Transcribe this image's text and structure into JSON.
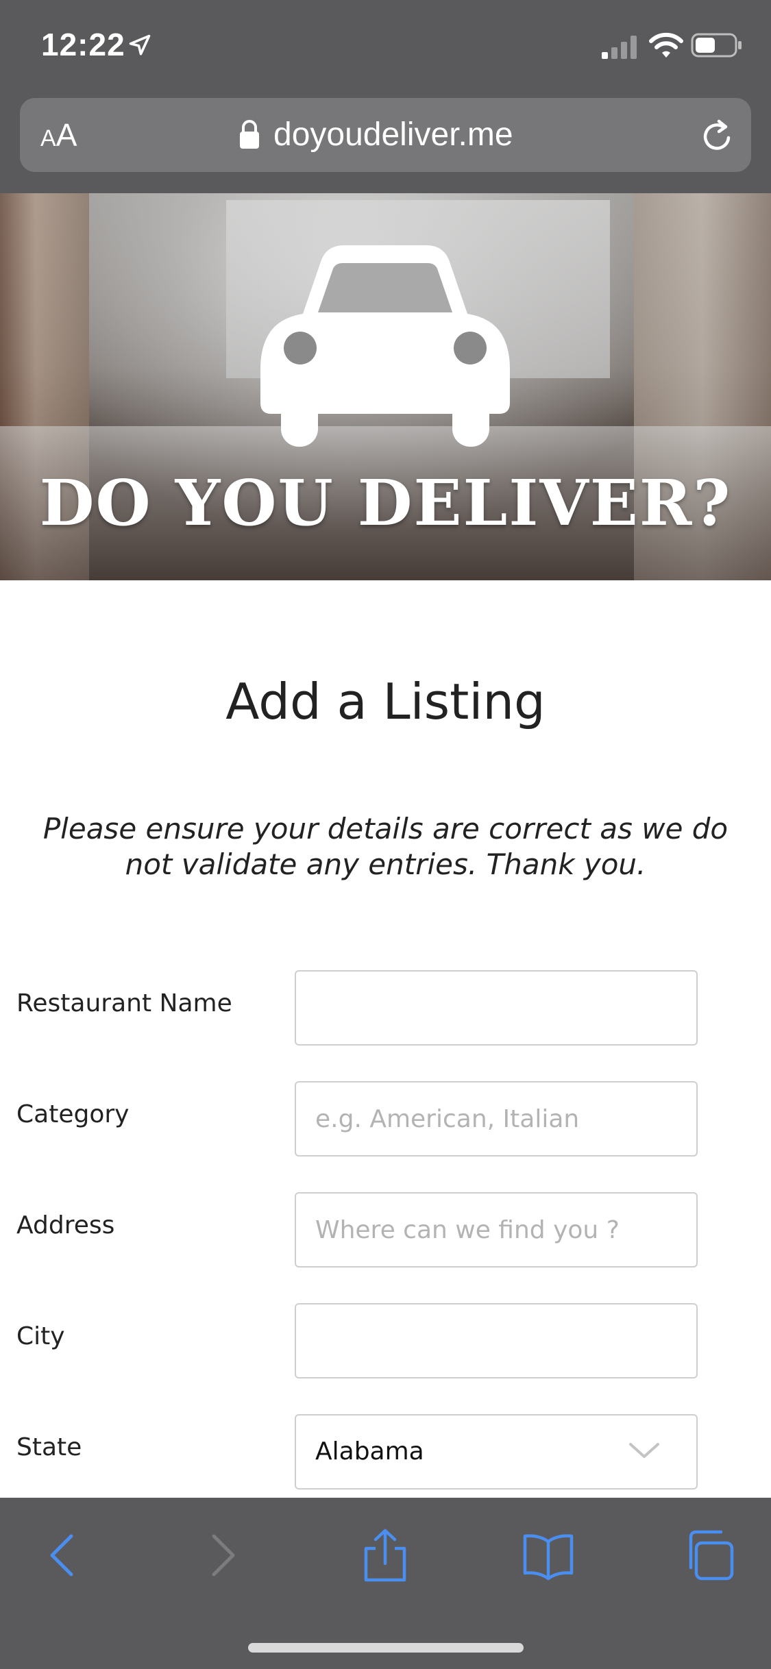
{
  "status_bar": {
    "time": "12:22"
  },
  "browser": {
    "text_size_small": "A",
    "text_size_large": "A",
    "url": "doyoudeliver.me"
  },
  "hero": {
    "title": "DO YOU DELIVER?"
  },
  "page": {
    "title": "Add a Listing",
    "notice": "Please ensure your details are correct as we do not validate any entries. Thank you."
  },
  "form": {
    "restaurant_name": {
      "label": "Restaurant Name",
      "value": "",
      "placeholder": ""
    },
    "category": {
      "label": "Category",
      "value": "",
      "placeholder": "e.g. American, Italian"
    },
    "address": {
      "label": "Address",
      "value": "",
      "placeholder": "Where can we find you ?"
    },
    "city": {
      "label": "City",
      "value": "",
      "placeholder": ""
    },
    "state": {
      "label": "State",
      "selected": "Alabama"
    }
  },
  "colors": {
    "chrome": "#5a5a5c",
    "toolbar_icon": "#4a8ef0",
    "toolbar_icon_disabled": "#7c7c80"
  },
  "toolbar": {
    "icons": [
      "back-icon",
      "forward-icon",
      "share-icon",
      "bookmarks-icon",
      "tabs-icon"
    ]
  }
}
